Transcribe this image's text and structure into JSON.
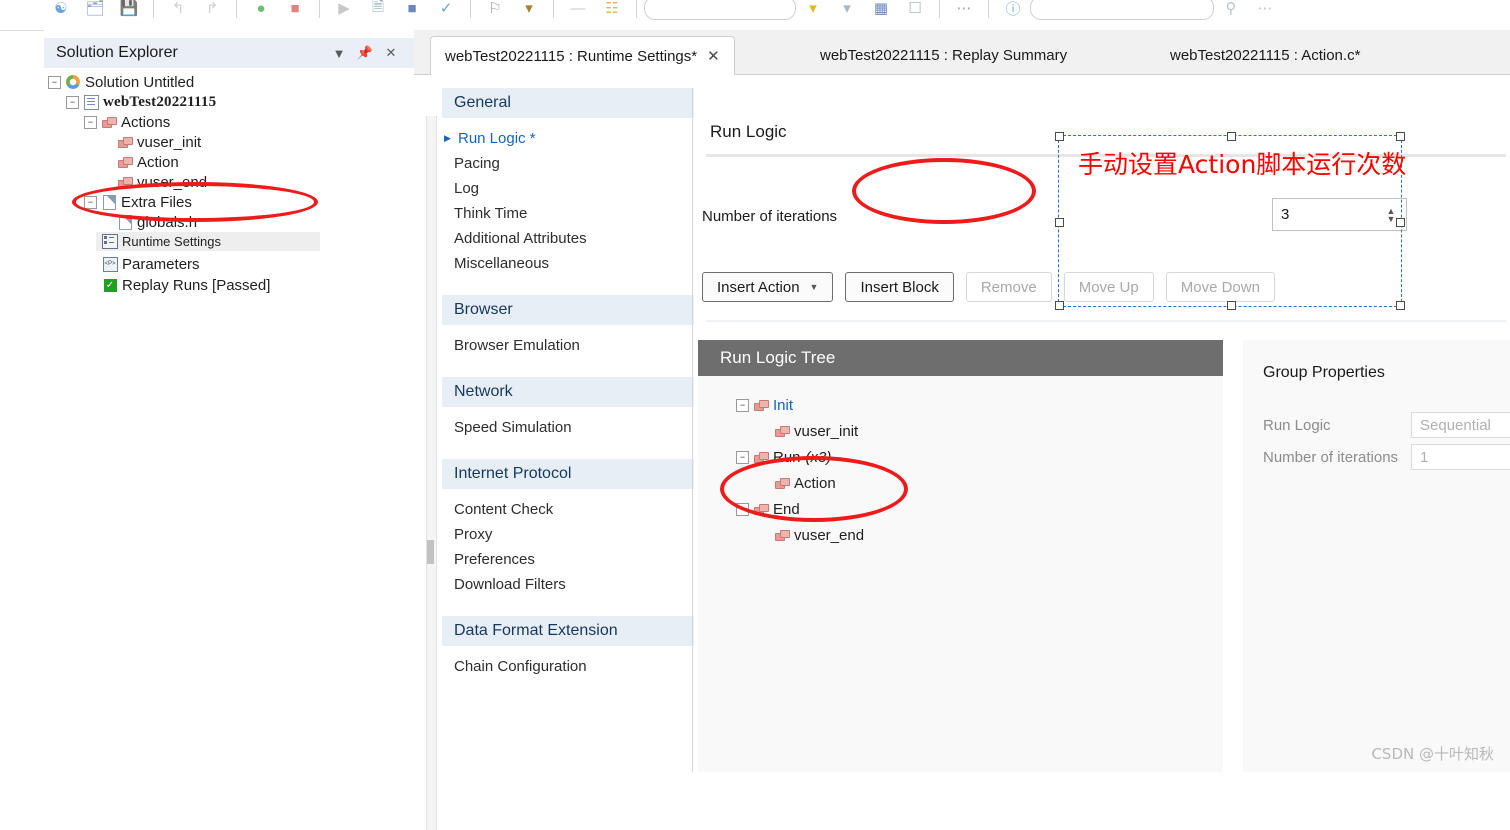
{
  "toolbar": {
    "icons": [
      "app-logo-icon",
      "open-icon",
      "save-icon",
      "undo-icon",
      "redo-icon",
      "record-icon",
      "stop-icon",
      "replay-icon",
      "compile-icon",
      "step-icon",
      "run-icon",
      "flag-icon",
      "pointer-icon",
      "dropdown-icon",
      "grid-icon",
      "window-icon",
      "zoom-icon",
      "help-icon",
      "search-icon"
    ]
  },
  "solution_explorer": {
    "title": "Solution Explorer",
    "header_icons": [
      "chevron-down-icon",
      "pin-icon",
      "close-icon"
    ],
    "tree": [
      {
        "label": "Solution Untitled",
        "icon": "solution-icon",
        "indent": 0,
        "toggle": "minus",
        "style": "normal"
      },
      {
        "label": "webTest20221115",
        "icon": "script-icon",
        "indent": 1,
        "toggle": "minus",
        "style": "bold-mono"
      },
      {
        "label": "Actions",
        "icon": "brick-icon",
        "indent": 2,
        "toggle": "minus",
        "style": "normal"
      },
      {
        "label": "vuser_init",
        "icon": "brick-icon",
        "indent": 3,
        "toggle": "none",
        "style": "normal"
      },
      {
        "label": "Action",
        "icon": "brick-icon",
        "indent": 3,
        "toggle": "none",
        "style": "normal"
      },
      {
        "label": "vuser_end",
        "icon": "brick-icon",
        "indent": 3,
        "toggle": "none",
        "style": "normal"
      },
      {
        "label": "Extra Files",
        "icon": "doc-icon",
        "indent": 2,
        "toggle": "minus",
        "style": "normal"
      },
      {
        "label": "globals.h",
        "icon": "file-icon",
        "indent": 3,
        "toggle": "none",
        "style": "normal"
      }
    ],
    "overlay_item": {
      "label": "Runtime Settings",
      "icon": "runtime-settings-icon"
    },
    "lower_items": [
      {
        "label": "Parameters",
        "icon": "parameters-icon"
      },
      {
        "label": "Replay Runs [Passed]",
        "icon": "passed-check-icon"
      }
    ]
  },
  "tabs": [
    {
      "label": "webTest20221115 : Runtime Settings*",
      "active": true,
      "closable": true
    },
    {
      "label": "webTest20221115 : Replay Summary",
      "active": false,
      "closable": false
    },
    {
      "label": "webTest20221115 : Action.c*",
      "active": false,
      "closable": false
    }
  ],
  "settings_list": [
    {
      "type": "group",
      "label": "General"
    },
    {
      "type": "item",
      "label": "Run Logic *",
      "selected": true
    },
    {
      "type": "item",
      "label": "Pacing",
      "selected": false
    },
    {
      "type": "item",
      "label": "Log",
      "selected": false
    },
    {
      "type": "item",
      "label": "Think Time",
      "selected": false
    },
    {
      "type": "item",
      "label": "Additional Attributes",
      "selected": false
    },
    {
      "type": "item",
      "label": "Miscellaneous",
      "selected": false
    },
    {
      "type": "gap"
    },
    {
      "type": "group",
      "label": "Browser"
    },
    {
      "type": "item",
      "label": "Browser Emulation",
      "selected": false
    },
    {
      "type": "gap"
    },
    {
      "type": "group",
      "label": "Network"
    },
    {
      "type": "item",
      "label": "Speed Simulation",
      "selected": false
    },
    {
      "type": "gap"
    },
    {
      "type": "group",
      "label": "Internet Protocol"
    },
    {
      "type": "item",
      "label": "Content Check",
      "selected": false
    },
    {
      "type": "item",
      "label": "Proxy",
      "selected": false
    },
    {
      "type": "item",
      "label": "Preferences",
      "selected": false
    },
    {
      "type": "item",
      "label": "Download Filters",
      "selected": false
    },
    {
      "type": "gap"
    },
    {
      "type": "group",
      "label": "Data Format Extension"
    },
    {
      "type": "item",
      "label": "Chain Configuration",
      "selected": false
    }
  ],
  "run_logic": {
    "title": "Run Logic",
    "iterations_label": "Number of iterations",
    "iterations_value": "3",
    "buttons": [
      {
        "label": "Insert Action",
        "caret": true,
        "disabled": false,
        "name": "insert-action-button"
      },
      {
        "label": "Insert Block",
        "caret": false,
        "disabled": false,
        "name": "insert-block-button"
      },
      {
        "label": "Remove",
        "caret": false,
        "disabled": true,
        "name": "remove-button"
      },
      {
        "label": "Move Up",
        "caret": false,
        "disabled": true,
        "name": "move-up-button"
      },
      {
        "label": "Move Down",
        "caret": false,
        "disabled": true,
        "name": "move-down-button"
      }
    ]
  },
  "run_logic_tree": {
    "header": "Run Logic Tree",
    "nodes": [
      {
        "label": "Init",
        "suffix": "",
        "level": 1,
        "toggle": "minus",
        "link": true
      },
      {
        "label": "vuser_init",
        "suffix": "",
        "level": 2,
        "toggle": "none",
        "link": false
      },
      {
        "label": "Run",
        "suffix": "(x3)",
        "level": 1,
        "toggle": "minus",
        "link": false
      },
      {
        "label": "Action",
        "suffix": "",
        "level": 2,
        "toggle": "none",
        "link": false
      },
      {
        "label": "End",
        "suffix": "",
        "level": 1,
        "toggle": "minus",
        "link": false
      },
      {
        "label": "vuser_end",
        "suffix": "",
        "level": 2,
        "toggle": "none",
        "link": false
      }
    ]
  },
  "group_properties": {
    "title": "Group Properties",
    "rows": [
      {
        "label": "Run Logic",
        "value": "Sequential"
      },
      {
        "label": "Number of iterations",
        "value": "1"
      }
    ]
  },
  "annotations": {
    "note_text": "手动设置Action脚本运行次数",
    "note_color": "#ff0000",
    "highlight_color": "#ee1b1b",
    "selection_border_color": "#2f6fd0",
    "watermark": "CSDN @十叶知秋"
  }
}
